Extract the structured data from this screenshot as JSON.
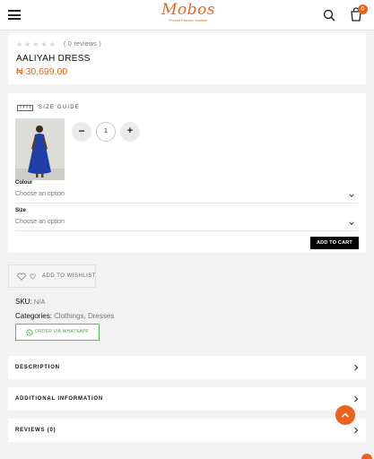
{
  "header": {
    "logo_text": "Mobos",
    "logo_tagline": "Pursuit Fashion Institute",
    "cart_count": "0"
  },
  "product": {
    "stars": "★★★★★",
    "reviews_count": "( 0 reviews )",
    "title": "AALIYAH DRESS",
    "price": "₦ 30,699.00"
  },
  "options": {
    "size_guide_label": "SIZE GUIDE",
    "quantity_minus": "−",
    "quantity": "1",
    "quantity_plus": "+",
    "colour_label": "Colour",
    "colour_value": "Choose an option",
    "size_label": "Size",
    "size_value": "Choose an option",
    "add_to_cart_label": "ADD TO CART"
  },
  "wishlist": {
    "label": "ADD TO WISHLIST"
  },
  "meta": {
    "sku_label": "SKU:",
    "sku_value": "N/A",
    "categories_label": "Categories:",
    "categories": [
      "Clothings",
      "Dresses"
    ],
    "category_separator": ",",
    "whatsapp_label": "ORDER VIA WHATSAPP"
  },
  "accordion": [
    {
      "label": "DESCRIPTION"
    },
    {
      "label": "ADDITIONAL INFORMATION"
    },
    {
      "label": "REVIEWS (0)"
    }
  ],
  "colors": {
    "accent": "#e8641e",
    "price": "#e8641e",
    "whatsapp": "#3bb03b",
    "button_bg": "#000000"
  },
  "icons": [
    "menu-icon",
    "search-icon",
    "cart-icon",
    "ruler-icon",
    "heart-icon",
    "whatsapp-icon",
    "chevron-down-icon",
    "chevron-right-icon",
    "arrow-up-icon"
  ]
}
